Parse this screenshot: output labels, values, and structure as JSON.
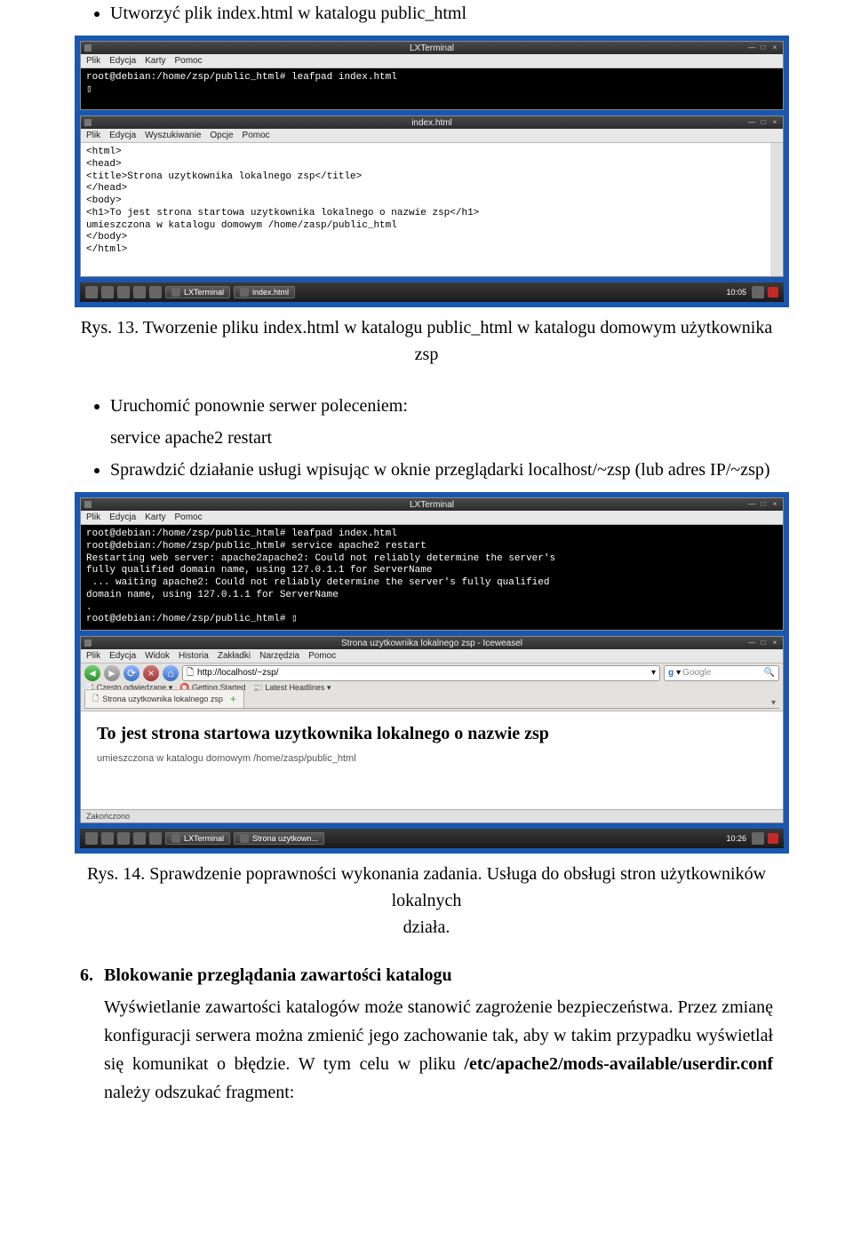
{
  "bullet1": "Utworzyć plik index.html w katalogu public_html",
  "shot1": {
    "lxterm_title": "LXTerminal",
    "menubar": [
      "Plik",
      "Edycja",
      "Karty",
      "Pomoc"
    ],
    "terminal_text": "root@debian:/home/zsp/public_html# leafpad index.html\n▯",
    "leafpad_title": "index.html",
    "leafpad_menubar": [
      "Plik",
      "Edycja",
      "Wyszukiwanie",
      "Opcje",
      "Pomoc"
    ],
    "editor_text": "<html>\n<head>\n<title>Strona uzytkownika lokalnego zsp</title>\n</head>\n<body>\n<h1>To jest strona startowa uzytkownika lokalnego o nazwie zsp</h1>\numieszczona w katalogu domowym /home/zasp/public_html\n</body>\n</html>",
    "taskbar_items": [
      "LXTerminal",
      "index.html"
    ],
    "clock": "10:05"
  },
  "caption1": "Rys. 13. Tworzenie pliku index.html w katalogu public_html w katalogu domowym użytkownika zsp",
  "bullet2": "Uruchomić ponownie serwer poleceniem:",
  "cmd1": "service apache2 restart",
  "bullet3": "Sprawdzić działanie usługi wpisując w oknie przeglądarki localhost/~zsp (lub adres IP/~zsp)",
  "shot2": {
    "lxterm_title": "LXTerminal",
    "menubar": [
      "Plik",
      "Edycja",
      "Karty",
      "Pomoc"
    ],
    "terminal_text": "root@debian:/home/zsp/public_html# leafpad index.html\nroot@debian:/home/zsp/public_html# service apache2 restart\nRestarting web server: apache2apache2: Could not reliably determine the server's\nfully qualified domain name, using 127.0.1.1 for ServerName\n ... waiting apache2: Could not reliably determine the server's fully qualified\ndomain name, using 127.0.1.1 for ServerName\n.\nroot@debian:/home/zsp/public_html# ▯",
    "browser_title": "Strona uzytkownika lokalnego zsp - Iceweasel",
    "browser_menubar": [
      "Plik",
      "Edycja",
      "Widok",
      "Historia",
      "Zakładki",
      "Narzędzia",
      "Pomoc"
    ],
    "url": "http://localhost/~zsp/",
    "search_engine": "Google",
    "bookmarks": [
      "Często odwiedzane",
      "Getting Started",
      "Latest Headlines"
    ],
    "tab_label": "Strona uzytkownika lokalnego zsp",
    "page_h1": "To jest strona startowa uzytkownika lokalnego o nazwie zsp",
    "page_sub": "umieszczona w katalogu domowym /home/zasp/public_html",
    "status": "Zakończono",
    "taskbar_items": [
      "LXTerminal",
      "Strona uzytkown..."
    ],
    "clock": "10:26"
  },
  "caption2_line1": "Rys. 14. Sprawdzenie poprawności wykonania zadania. Usługa do obsługi stron użytkowników lokalnych",
  "caption2_line2": "działa.",
  "section6": {
    "number": "6.",
    "title": "Blokowanie przeglądania zawartości katalogu",
    "body_prefix": "Wyświetlanie zawartości katalogów może stanowić zagrożenie bezpieczeństwa. Przez zmianę konfiguracji serwera można zmienić jego zachowanie tak, aby w takim przypadku wyświetlał się komunikat o błędzie. W tym celu w pliku ",
    "body_bold": "/etc/apache2/mods-available/userdir.conf",
    "body_suffix": " należy odszukać fragment:"
  }
}
